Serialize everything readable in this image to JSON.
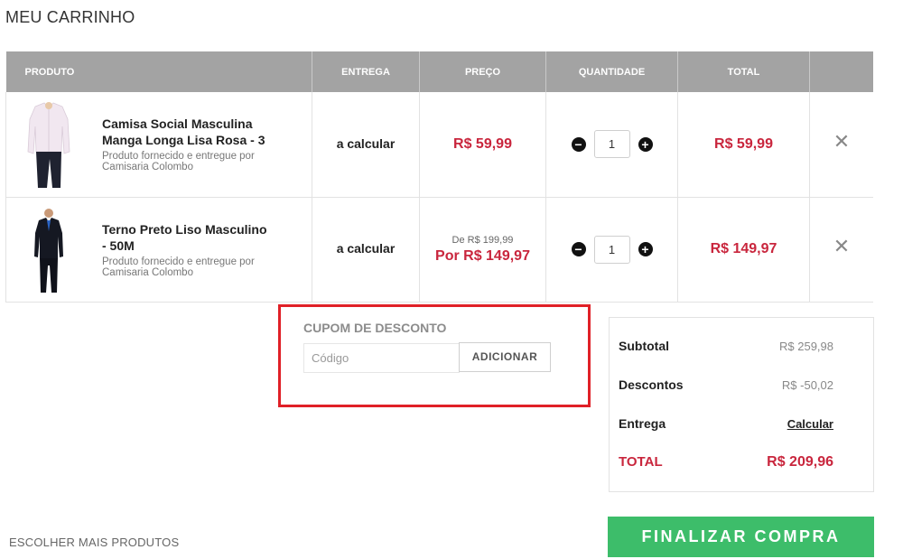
{
  "page_title": "MEU CARRINHO",
  "table": {
    "headers": {
      "product": "PRODUTO",
      "delivery": "ENTREGA",
      "price": "PREÇO",
      "quantity": "QUANTIDADE",
      "total": "TOTAL"
    },
    "items": [
      {
        "name": "Camisa Social Masculina Manga Longa Lisa Rosa - 3",
        "seller": "Produto fornecido e entregue por Camisaria Colombo",
        "image_icon": "shirt-product-image",
        "delivery": "a calcular",
        "old_price": "",
        "price": "R$ 59,99",
        "quantity": "1",
        "total": "R$ 59,99",
        "remove": "✕"
      },
      {
        "name": "Terno Preto Liso Masculino - 50M",
        "seller": "Produto fornecido e entregue por Camisaria Colombo",
        "image_icon": "suit-product-image",
        "delivery": "a calcular",
        "old_price": "De R$ 199,99",
        "price": "Por R$ 149,97",
        "quantity": "1",
        "total": "R$ 149,97",
        "remove": "✕"
      }
    ]
  },
  "coupon": {
    "title": "CUPOM DE DESCONTO",
    "placeholder": "Código",
    "button": "ADICIONAR",
    "highlight_color": "#e02027"
  },
  "summary": {
    "subtotal_label": "Subtotal",
    "subtotal_value": "R$ 259,98",
    "discount_label": "Descontos",
    "discount_value": "R$ -50,02",
    "delivery_label": "Entrega",
    "delivery_link": "Calcular",
    "total_label": "TOTAL",
    "total_value": "R$ 209,96"
  },
  "actions": {
    "more_products": "ESCOLHER MAIS PRODUTOS",
    "checkout": "FINALIZAR COMPRA"
  },
  "colors": {
    "header_bg": "#a3a3a3",
    "price_red": "#c9263d",
    "checkout_green": "#3dbd6a"
  }
}
